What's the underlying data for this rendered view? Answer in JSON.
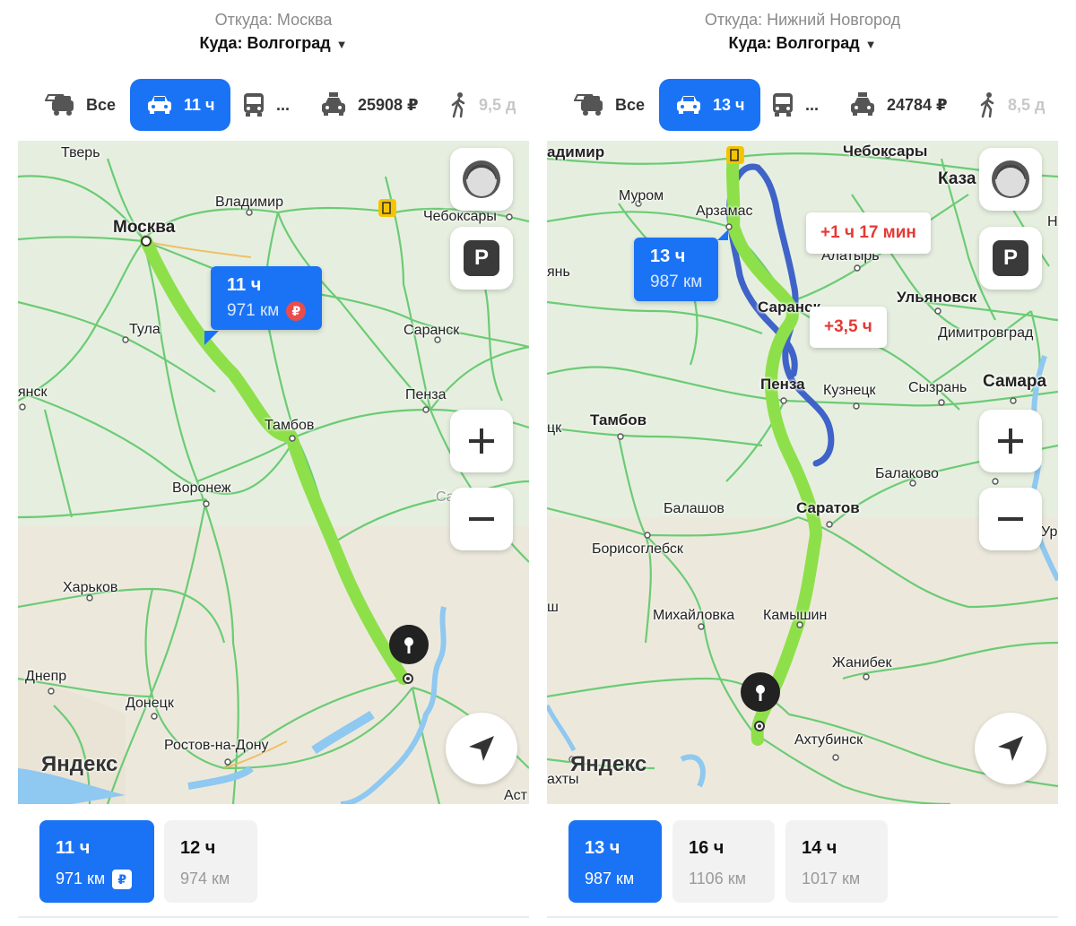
{
  "left": {
    "header": {
      "from": "Откуда: Москва",
      "to": "Куда: Волгоград"
    },
    "modes": {
      "all": "Все",
      "car": "11 ч",
      "bus": "...",
      "taxi": "25908 ₽",
      "walk": "9,5 д"
    },
    "map": {
      "cities": {
        "tver": "Тверь",
        "moskva": "Москва",
        "vladimir": "Владимир",
        "cheboksary": "Чебоксары",
        "tula": "Тула",
        "saransk": "Саранск",
        "yansk": "янск",
        "penza": "Пенза",
        "tambov": "Тамбов",
        "voronezh": "Воронеж",
        "saratov": "Саратов",
        "kharkov": "Харьков",
        "dnepr": "Днепр",
        "donetsk": "Донецк",
        "rostov": "Ростов-на-Дону",
        "ast": "Аст"
      },
      "logo": "Яндекс",
      "route_bubble": {
        "time": "11 ч",
        "distance": "971 км",
        "toll": "₽"
      },
      "parking": "P"
    },
    "routes": [
      {
        "time": "11 ч",
        "distance": "971 км",
        "toll": "₽",
        "selected": true
      },
      {
        "time": "12 ч",
        "distance": "974 км",
        "selected": false
      }
    ]
  },
  "right": {
    "header": {
      "from": "Откуда: Нижний Новгород",
      "to": "Куда: Волгоград"
    },
    "modes": {
      "all": "Все",
      "car": "13 ч",
      "bus": "...",
      "taxi": "24784 ₽",
      "walk": "8,5 д"
    },
    "map": {
      "cities": {
        "vladimir": "адимир",
        "cheboksary": "Чебоксары",
        "kazan": "Каза",
        "murom": "Муром",
        "arzamas": "Арзамас",
        "n": "Н",
        "alatyr": "Алатырь",
        "yan": "янь",
        "saransk": "Саранск",
        "ulyanovsk": "Ульяновск",
        "dimitrovgrad": "Димитровград",
        "tambov": "Тамбов",
        "penza": "Пенза",
        "kuznetsk": "Кузнецк",
        "syzran": "Сызрань",
        "samara": "Самара",
        "ck": "цк",
        "balakovo": "Балаково",
        "balashov": "Балашов",
        "saratov": "Саратов",
        "borisoglebsk": "Борисоглебск",
        "ur": "Ур",
        "sh": "ш",
        "mikhaylovka": "Михайловка",
        "kamyshin": "Камышин",
        "zhanibek": "Жанибек",
        "akhtubinsk": "Ахтубинск",
        "shakhty": "ахты"
      },
      "logo": "Яндекс",
      "route_bubble": {
        "time": "13 ч",
        "distance": "987 км"
      },
      "alt1": "+1 ч 17 мин",
      "alt2": "+3,5 ч",
      "parking": "P"
    },
    "routes": [
      {
        "time": "13 ч",
        "distance": "987 км",
        "selected": true
      },
      {
        "time": "16 ч",
        "distance": "1106 км",
        "selected": false
      },
      {
        "time": "14 ч",
        "distance": "1017 км",
        "selected": false
      }
    ]
  },
  "colors": {
    "accent": "#1a73f5",
    "route": "#8ee04a",
    "alt_route": "#3f63c8",
    "road": "#5fc86a",
    "delay": "#e53935"
  }
}
